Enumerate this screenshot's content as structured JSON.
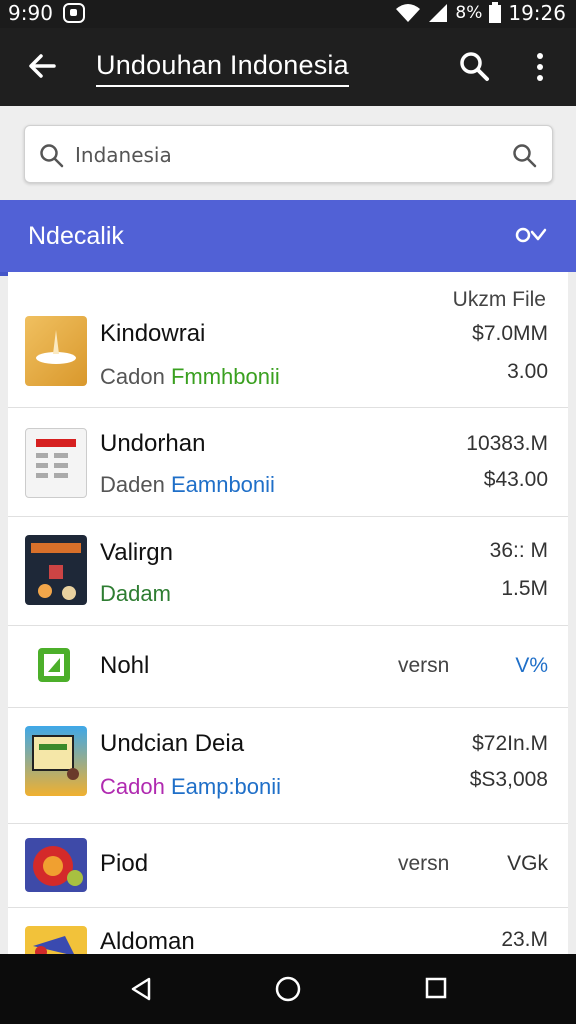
{
  "status": {
    "time_left": "9:90",
    "battery_pct": "8%",
    "time_right": "19:26"
  },
  "appbar": {
    "title": "Undouhan Indonesia"
  },
  "search": {
    "value": "Indanesia"
  },
  "tab": {
    "label": "Ndecalik"
  },
  "list": {
    "header": "Ukzm File",
    "items": [
      {
        "name": "Kindowrai",
        "sub_prefix": "Cadon",
        "sub_accent": "Fmmhbonii",
        "accent_color": "#3aa020",
        "val1": "$7.0MM",
        "val2": "3.00"
      },
      {
        "name": "Undorhan",
        "sub_prefix": "Daden",
        "sub_accent": "Eamnbonii",
        "accent_color": "#1f6fc8",
        "val1": "10383.M",
        "val2": "$43.00"
      },
      {
        "name": "Valirgn",
        "sub_prefix": "",
        "sub_accent": "Dadam",
        "accent_color": "#2e7d32",
        "val1": "36:: M",
        "val2": "1.5M"
      },
      {
        "name": "Nohl",
        "mid": "versn",
        "val1": "V%"
      },
      {
        "name": "Undcian Deia",
        "sub_prefix": "",
        "sub_accent": "Cadoh",
        "sub_accent2": "Eamp:bonii",
        "accent_color": "#b02ab0",
        "accent_color2": "#1f6fc8",
        "val1": "$72In.M",
        "val2": "$S3,008"
      },
      {
        "name": "Piod",
        "mid": "versn",
        "val1": "VGk"
      },
      {
        "name": "Aldoman",
        "val1": "23.M"
      }
    ]
  },
  "icons": {
    "back": "arrow-left-icon",
    "search": "search-icon",
    "more": "more-vert-icon",
    "nav_back": "triangle-back-icon",
    "nav_home": "circle-home-icon",
    "nav_recents": "square-recents-icon"
  },
  "colors": {
    "accent": "#5161d6",
    "appbar": "#1f1f1f"
  }
}
